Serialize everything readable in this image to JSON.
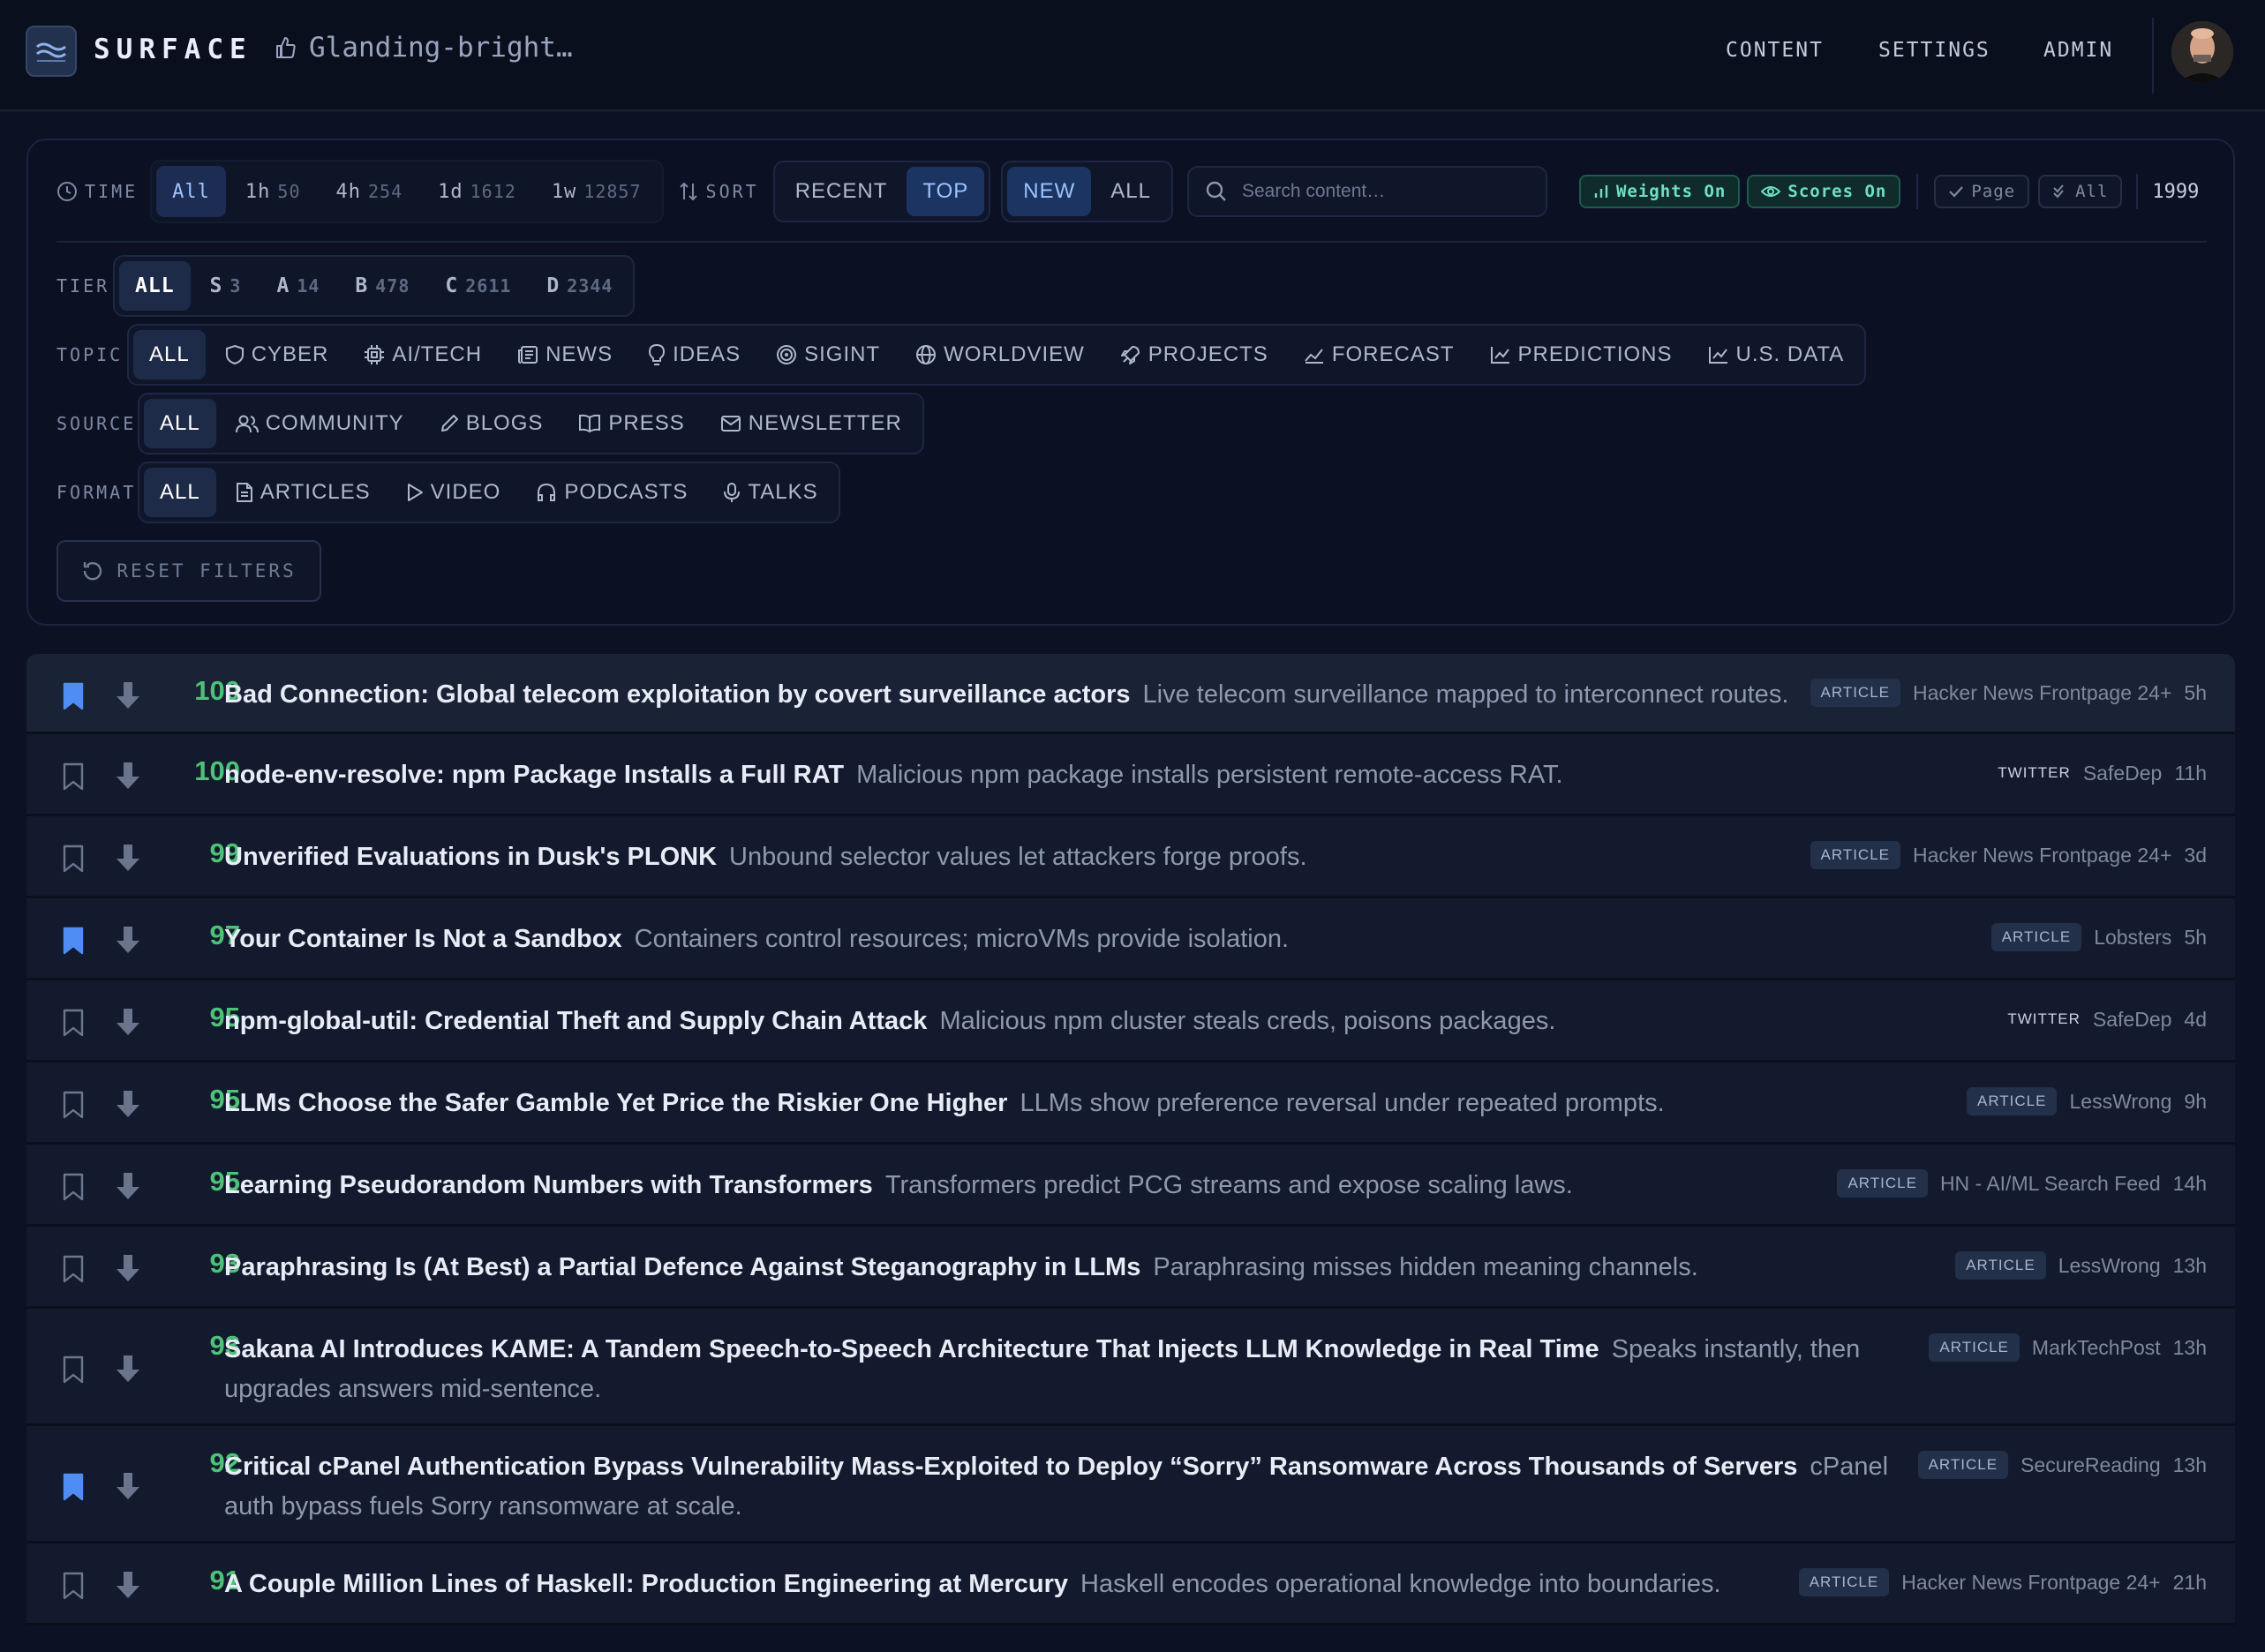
{
  "header": {
    "brand": "SURFACE",
    "breadcrumb": "Glanding-bright…",
    "nav": [
      "CONTENT",
      "SETTINGS",
      "ADMIN"
    ]
  },
  "filters": {
    "time": {
      "label": "TIME",
      "options": [
        {
          "label": "All",
          "count": ""
        },
        {
          "label": "1h",
          "count": "50"
        },
        {
          "label": "4h",
          "count": "254"
        },
        {
          "label": "1d",
          "count": "1612"
        },
        {
          "label": "1w",
          "count": "12857"
        }
      ]
    },
    "sort": {
      "label": "SORT",
      "options": [
        "RECENT",
        "TOP"
      ]
    },
    "scope": {
      "options": [
        "NEW",
        "ALL"
      ]
    },
    "search_placeholder": "Search content…",
    "toggles": {
      "weights": "Weights On",
      "scores": "Scores On",
      "page": "Page",
      "all": "All"
    },
    "total": "1999",
    "tier": {
      "label": "TIER",
      "options": [
        {
          "label": "ALL",
          "count": ""
        },
        {
          "label": "S",
          "count": "3"
        },
        {
          "label": "A",
          "count": "14"
        },
        {
          "label": "B",
          "count": "478"
        },
        {
          "label": "C",
          "count": "2611"
        },
        {
          "label": "D",
          "count": "2344"
        }
      ]
    },
    "topic": {
      "label": "TOPIC",
      "options": [
        "ALL",
        "CYBER",
        "AI/TECH",
        "NEWS",
        "IDEAS",
        "SIGINT",
        "WORLDVIEW",
        "PROJECTS",
        "FORECAST",
        "PREDICTIONS",
        "U.S. DATA"
      ]
    },
    "source": {
      "label": "SOURCE",
      "options": [
        "ALL",
        "COMMUNITY",
        "BLOGS",
        "PRESS",
        "NEWSLETTER"
      ]
    },
    "format": {
      "label": "FORMAT",
      "options": [
        "ALL",
        "ARTICLES",
        "VIDEO",
        "PODCASTS",
        "TALKS"
      ]
    },
    "reset": "RESET FILTERS"
  },
  "colors": {
    "accent": "#3b82f6",
    "score": "#4cc277",
    "background": "#0c1223"
  },
  "items": [
    {
      "score": "100",
      "title": "Bad Connection: Global telecom exploitation by covert surveillance actors",
      "summary": "Live telecom surveillance mapped to interconnect routes.",
      "type": "ARTICLE",
      "source": "Hacker News Frontpage 24+",
      "age": "5h",
      "bookmarked": true
    },
    {
      "score": "100",
      "title": "node-env-resolve: npm Package Installs a Full RAT",
      "summary": "Malicious npm package installs persistent remote-access RAT.",
      "type": "TWITTER",
      "source": "SafeDep",
      "age": "11h",
      "bookmarked": false
    },
    {
      "score": "99",
      "title": "Unverified Evaluations in Dusk's PLONK",
      "summary": "Unbound selector values let attackers forge proofs.",
      "type": "ARTICLE",
      "source": "Hacker News Frontpage 24+",
      "age": "3d",
      "bookmarked": false
    },
    {
      "score": "97",
      "title": "Your Container Is Not a Sandbox",
      "summary": "Containers control resources; microVMs provide isolation.",
      "type": "ARTICLE",
      "source": "Lobsters",
      "age": "5h",
      "bookmarked": true
    },
    {
      "score": "95",
      "title": "npm-global-util: Credential Theft and Supply Chain Attack",
      "summary": "Malicious npm cluster steals creds, poisons packages.",
      "type": "TWITTER",
      "source": "SafeDep",
      "age": "4d",
      "bookmarked": false
    },
    {
      "score": "95",
      "title": "LLMs Choose the Safer Gamble Yet Price the Riskier One Higher",
      "summary": "LLMs show preference reversal under repeated prompts.",
      "type": "ARTICLE",
      "source": "LessWrong",
      "age": "9h",
      "bookmarked": false
    },
    {
      "score": "95",
      "title": "Learning Pseudorandom Numbers with Transformers",
      "summary": "Transformers predict PCG streams and expose scaling laws.",
      "type": "ARTICLE",
      "source": "HN - AI/ML Search Feed",
      "age": "14h",
      "bookmarked": false
    },
    {
      "score": "93",
      "title": "Paraphrasing Is (At Best) a Partial Defence Against Steganography in LLMs",
      "summary": "Paraphrasing misses hidden meaning channels.",
      "type": "ARTICLE",
      "source": "LessWrong",
      "age": "13h",
      "bookmarked": false
    },
    {
      "score": "93",
      "title": "Sakana AI Introduces KAME: A Tandem Speech-to-Speech Architecture That Injects LLM Knowledge in Real Time",
      "summary": "Speaks instantly, then upgrades answers mid-sentence.",
      "type": "ARTICLE",
      "source": "MarkTechPost",
      "age": "13h",
      "bookmarked": false
    },
    {
      "score": "92",
      "title": "Critical cPanel Authentication Bypass Vulnerability Mass-Exploited to Deploy “Sorry” Ransomware Across Thousands of Servers",
      "summary": "cPanel auth bypass fuels Sorry ransomware at scale.",
      "type": "ARTICLE",
      "source": "SecureReading",
      "age": "13h",
      "bookmarked": true
    },
    {
      "score": "91",
      "title": "A Couple Million Lines of Haskell: Production Engineering at Mercury",
      "summary": "Haskell encodes operational knowledge into boundaries.",
      "type": "ARTICLE",
      "source": "Hacker News Frontpage 24+",
      "age": "21h",
      "bookmarked": false
    }
  ]
}
